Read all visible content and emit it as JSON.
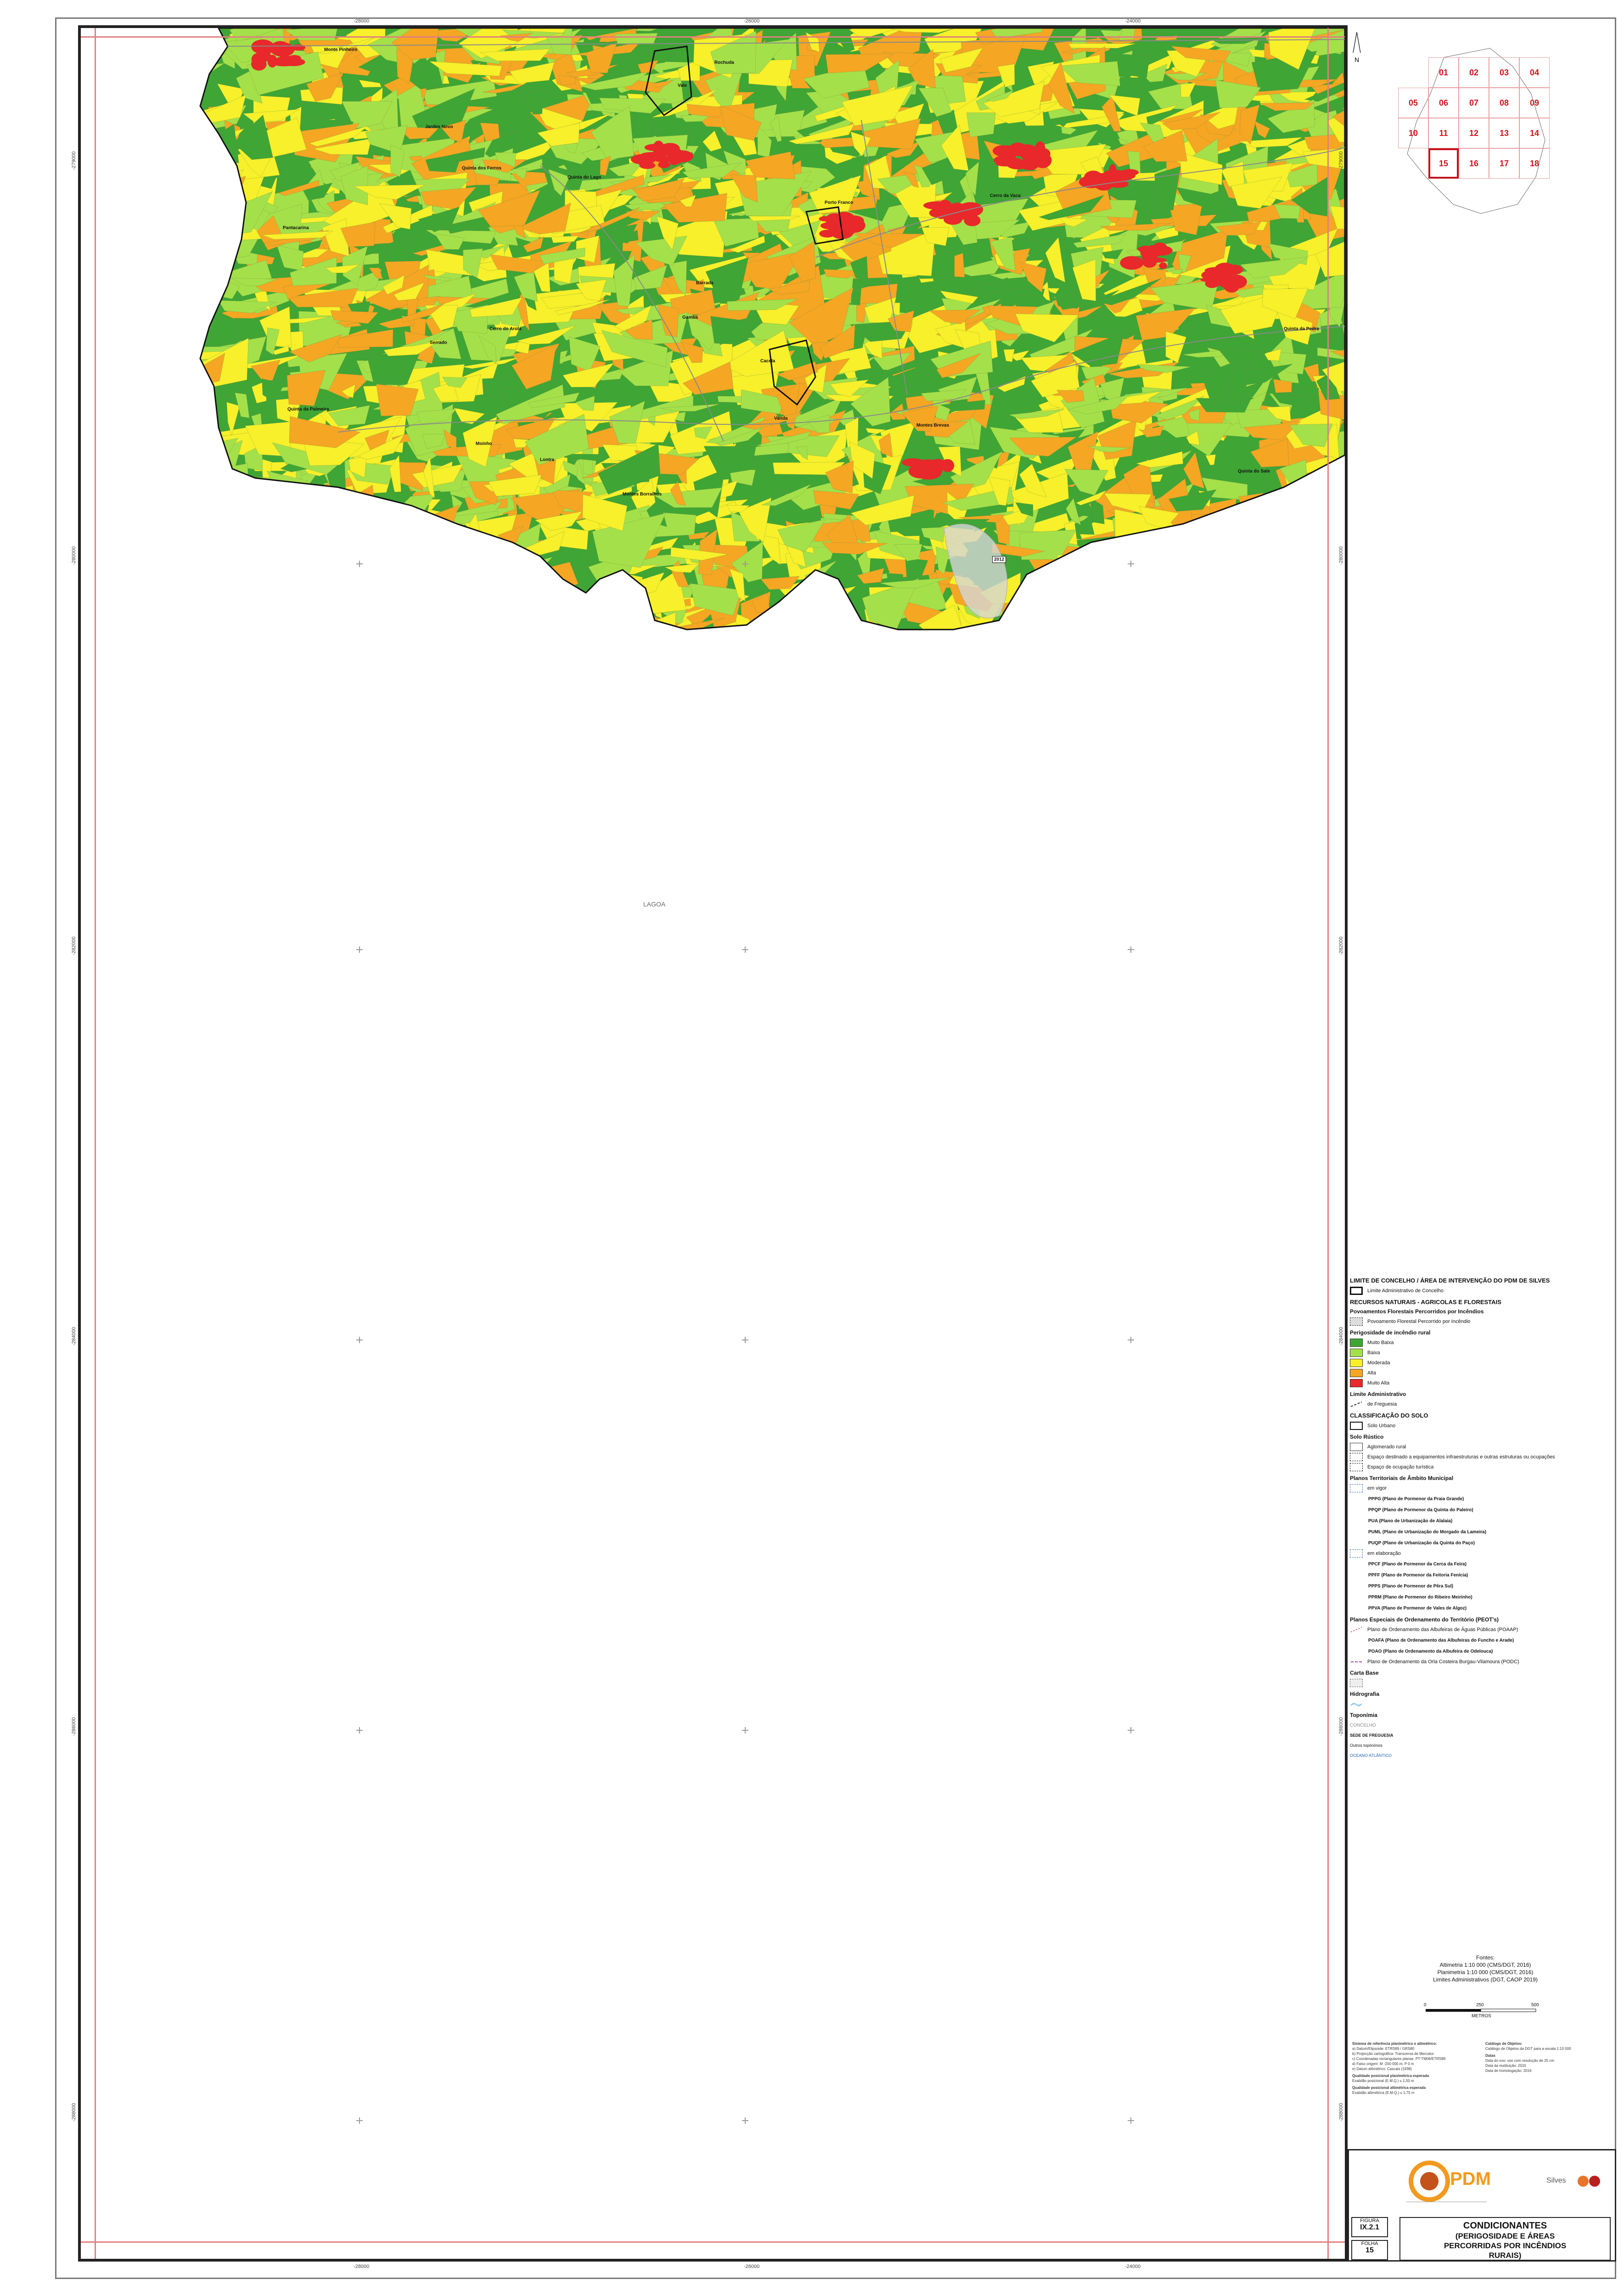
{
  "map": {
    "coords_top": [
      "-28000",
      "-26000",
      "-24000"
    ],
    "coords_bottom": [
      "-28000",
      "-26000",
      "-24000"
    ],
    "coords_left": [
      "-279000",
      "-280000",
      "-282000",
      "-284000",
      "-286000",
      "-288000"
    ],
    "coords_right": [
      "-279000",
      "-280000",
      "-282000",
      "-284000",
      "-286000",
      "-288000"
    ],
    "places": [
      "Monte Pinheiro",
      "Rochuda",
      "Vale",
      "Jardim Novo",
      "Quinta dos Ferros",
      "Quinta do Lago",
      "Porto Franco",
      "Barrada",
      "Cerro da Vaca",
      "Pantacarina",
      "Serrado",
      "Cerro do Arola",
      "Gamba",
      "Cacela",
      "Quinta da Pedra",
      "Quinta da Palmeira",
      "Vanda",
      "Moinho",
      "Lontra",
      "Montes Brevas",
      "Montes Borralhos",
      "Quinta do Sale"
    ],
    "marker_label": "2012",
    "lagoa_label": "LAGOA",
    "colors": {
      "muito_baixa": "#3fa535",
      "baixa": "#a4e04a",
      "moderada": "#f7f02a",
      "alta": "#f5a623",
      "muito_alta": "#e8282b"
    }
  },
  "index": {
    "cells": [
      "01",
      "02",
      "03",
      "04",
      "05",
      "06",
      "07",
      "08",
      "09",
      "10",
      "11",
      "12",
      "13",
      "14",
      "15",
      "16",
      "17",
      "18"
    ],
    "current": "15",
    "north_label": "N"
  },
  "legend": {
    "h_limite_concelho": "LIMITE DE CONCELHO / ÁREA DE INTERVENÇÃO DO PDM DE SILVES",
    "limite_admin_concelho": "Limite Administrativo de Concelho",
    "h_recursos": "RECURSOS NATURAIS - AGRICOLAS E FLORESTAIS",
    "h_povoamentos": "Povoamentos Florestais Percorridos por Incêndios",
    "povoamento": "Povoamento Florestal Percorrido por Incêndio",
    "h_perigosidade": "Perigosidade de incêndio rural",
    "classes": [
      "Muito Baixa",
      "Baixa",
      "Moderada",
      "Alta",
      "Muito Alta"
    ],
    "h_limite_admin": "Limite Administrativo",
    "freguesia": "de Freguesia",
    "h_classificacao": "CLASSIFICAÇÃO DO SOLO",
    "solo_urbano": "Solo Urbano",
    "h_solo_rustico": "Solo Rústico",
    "aglomerado": "Aglomerado rural",
    "espaco_equip": "Espaço destinado a equipamentos infraestruturas e outras estruturas ou ocupações",
    "espaco_turistico": "Espaço de ocupação turística",
    "h_planos": "Planos Territoriais de Âmbito Municipal",
    "em_vigor": "em vigor",
    "planos_vigor": [
      "PPPG (Plano de Pormenor da Praia Grande)",
      "PPQP (Plano de Pormenor da Quinta do Paleiro)",
      "PUA (Plano de Urbanização de Alalaia)",
      "PUML (Plano de Urbanização do Morgado da Lameira)",
      "PUQP (Plano de Urbanização da Quinta do Paço)"
    ],
    "em_elaboracao": "em elaboração",
    "planos_elab": [
      "PPCF (Plano de Pormenor da Cerca da Feira)",
      "PPFF (Plano de Pormenor da Feitoria Fenícia)",
      "PPPS (Plano de Pormenor de Pêra Sul)",
      "PPRM (Plano de Pormenor do Ribeiro Meirinho)",
      "PPVA (Plano de Pormenor de Vales de Algoz)"
    ],
    "h_peot": "Planos Especiais de Ordenamento do Território (PEOT's)",
    "poaap": "Plano de Ordenamento das Albufeiras de Águas Públicas (POAAP)",
    "poafa": "POAFA (Plano de Ordenamento das Albufeiras do Funcho e Arade)",
    "poao": "POAO (Plano de Ordenamento da Albufeira de Odelouca)",
    "podc": "Plano de Ordenamento da Orla Costeira Burgau-Vilamoura (PODC)",
    "h_carta_base": "Carta Base",
    "h_hidrografia": "Hidrografia",
    "h_toponimia": "Toponímia",
    "concelho": "CONCELHO",
    "sede": "SEDE DE FREGUESIA",
    "outros": "Outros topónimos",
    "oceano": "OCEANO ATLÂNTICO"
  },
  "sources": {
    "title": "Fontes:",
    "lines": [
      "Altimetria 1:10 000 (CMS/DGT, 2016)",
      "Planimetria 1:10 000 (CMS/DGT, 2016)",
      "Limites Administrativos (DGT, CAOP 2019)"
    ]
  },
  "scale": {
    "ticks": [
      "0",
      "250",
      "500"
    ],
    "unit": "METROS"
  },
  "tech": {
    "h1": "Sistema de referência planimétrico e altimétrico:",
    "l1": [
      "a) Datum/Elipsoide: ETRS89 / GRS80",
      "b) Projecção cartográfica: Transversa de Mercator",
      "c) Coordenadas rectangulares planas: PT-TM06/ETRS89",
      "d) Falso origem: M -200 000 m; P 0 m",
      "e) Datum altimétrico: Cascais (1938)"
    ],
    "h2": "Qualidade posicional planimétrica esperada",
    "l2": [
      "Exatidão posicional (E.M.Q.) ≤ 1,50 m"
    ],
    "h3": "Qualidade posicional altimétrica esperada",
    "l3": [
      "Exatidão altimétrica (E.M.Q.) ≤ 1,75 m"
    ],
    "h4": "Catálogo de Objetos:",
    "l4": [
      "Catálogo de Objetos da DGT para a escala 1:10 000"
    ],
    "h5": "Datas",
    "l5": [
      "Data do voo: voo com resolução de 25 cm",
      "Data da restituição: 2015",
      "Data de homologação: 2016"
    ]
  },
  "title_block": {
    "fig_label": "FIGURA",
    "fig_value": "IX.2.1",
    "folha_label": "FOLHA",
    "folha_value": "15",
    "title_line1": "CONDICIONANTES",
    "title_line2": "(PERIGOSIDADE E ÁREAS",
    "title_line3": "PERCORRIDAS POR INCÊNDIOS",
    "title_line4": "RURAIS)",
    "logo_text": "PDM",
    "silves_text": "Silves"
  }
}
